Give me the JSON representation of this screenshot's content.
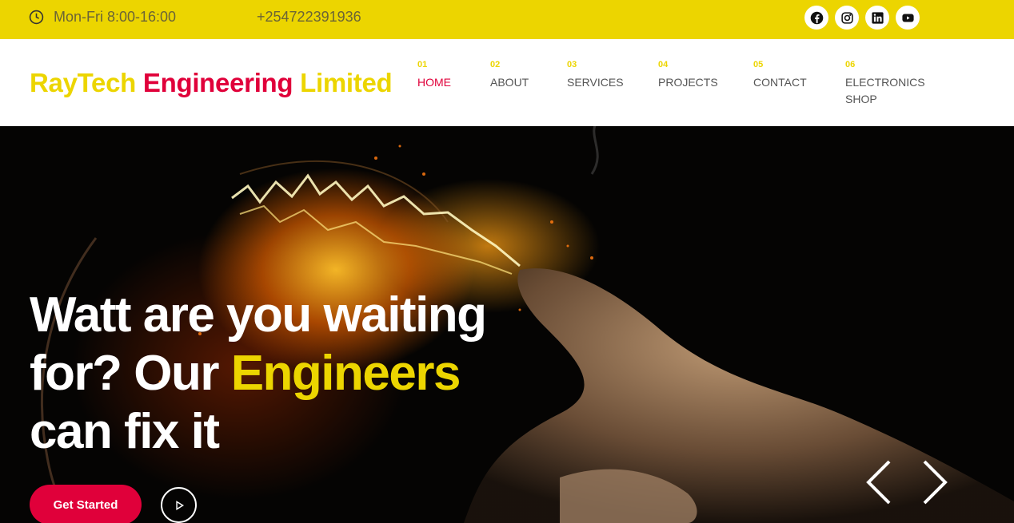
{
  "topbar": {
    "hours": "Mon-Fri 8:00-16:00",
    "phone": "+254722391936",
    "socials": [
      "facebook-icon",
      "instagram-icon",
      "linkedin-icon",
      "youtube-icon"
    ]
  },
  "header": {
    "logo": {
      "part1": "RayTech ",
      "part2": "Engineering ",
      "part3": "Limited"
    },
    "nav": [
      {
        "num": "01",
        "label": "HOME"
      },
      {
        "num": "02",
        "label": "ABOUT"
      },
      {
        "num": "03",
        "label": "SERVICES"
      },
      {
        "num": "04",
        "label": "PROJECTS"
      },
      {
        "num": "05",
        "label": "CONTACT"
      },
      {
        "num": "06",
        "label": "ELECTRONICS SHOP"
      }
    ]
  },
  "hero": {
    "title_part1": "Watt are you waiting for? Our ",
    "title_highlight": "Engineers",
    "title_part2": " can fix it",
    "cta": "Get Started"
  },
  "colors": {
    "accent_yellow": "#ecd500",
    "accent_red": "#e0003a",
    "text_gray": "#555555"
  }
}
